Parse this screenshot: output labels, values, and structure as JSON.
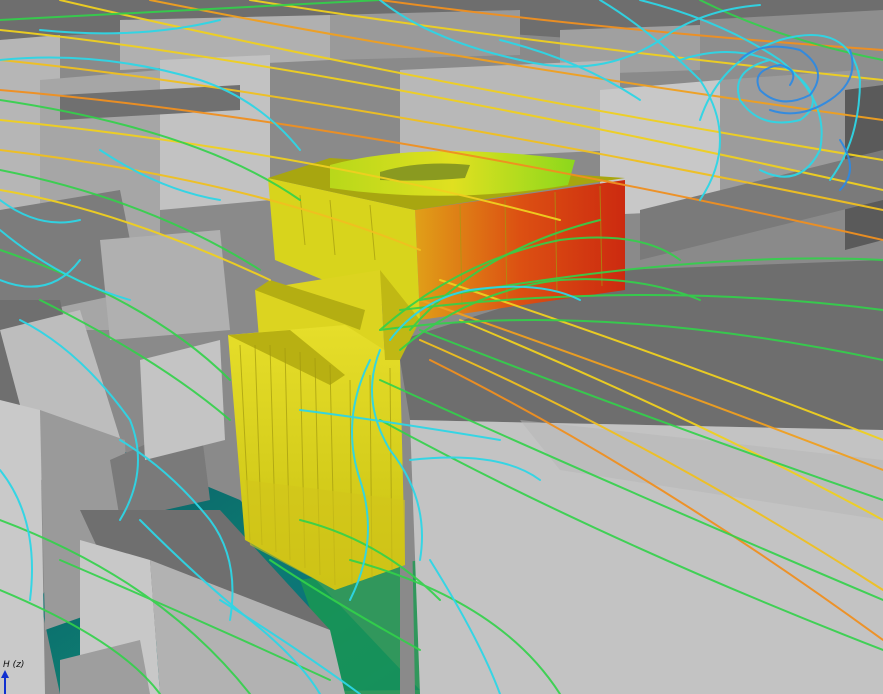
{
  "viewport": {
    "axis_indicator_label": "H (z)",
    "axis_indicator_icon": "z-axis-arrow-icon",
    "colors": {
      "background_buildings": "#a8a8a8",
      "target_building_low": "#d8d21a",
      "target_building_high": "#d83a10",
      "ground_plane": "#0d6c78",
      "streamline_low": "#2ed6e6",
      "streamline_mid": "#32d24a",
      "streamline_high": "#f0d020",
      "streamline_peak": "#f09020"
    }
  }
}
